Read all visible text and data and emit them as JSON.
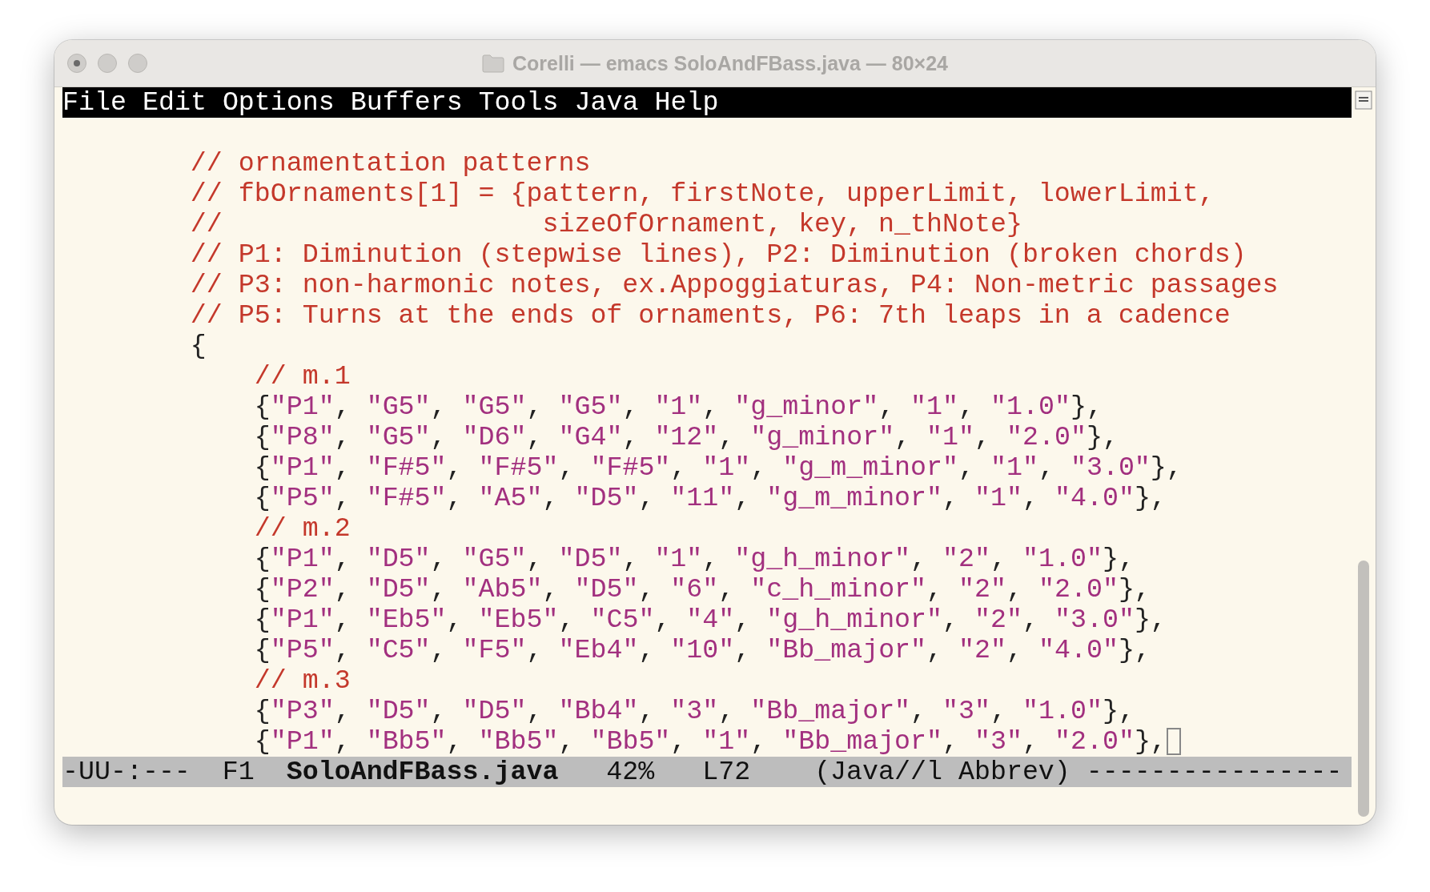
{
  "window": {
    "title": "Corelli — emacs SoloAndFBass.java — 80×24"
  },
  "menu_bar": [
    "File",
    "Edit",
    "Options",
    "Buffers",
    "Tools",
    "Java",
    "Help"
  ],
  "header_comments": [
    "// ornamentation patterns",
    "// fbOrnaments[1] = {pattern, firstNote, upperLimit, lowerLimit,",
    "//                    sizeOfOrnament, key, n_thNote}",
    "// P1: Diminution (stepwise lines), P2: Diminution (broken chords)",
    "// P3: non-harmonic notes, ex.Appoggiaturas, P4: Non-metric passages",
    "// P5: Turns at the ends of ornaments, P6: 7th leaps in a cadence"
  ],
  "block": {
    "open": "{",
    "groups": [
      {
        "comment": "// m.1",
        "rows": [
          {
            "text": "{\"P1\", \"G5\", \"G5\", \"G5\", \"1\", \"g_minor\", \"1\", \"1.0\"},",
            "cursor": false
          },
          {
            "text": "{\"P8\", \"G5\", \"D6\", \"G4\", \"12\", \"g_minor\", \"1\", \"2.0\"},",
            "cursor": false
          },
          {
            "text": "{\"P1\", \"F#5\", \"F#5\", \"F#5\", \"1\", \"g_m_minor\", \"1\", \"3.0\"},",
            "cursor": false
          },
          {
            "text": "{\"P5\", \"F#5\", \"A5\", \"D5\", \"11\", \"g_m_minor\", \"1\", \"4.0\"},",
            "cursor": false
          }
        ]
      },
      {
        "comment": "// m.2",
        "rows": [
          {
            "text": "{\"P1\", \"D5\", \"G5\", \"D5\", \"1\", \"g_h_minor\", \"2\", \"1.0\"},",
            "cursor": false
          },
          {
            "text": "{\"P2\", \"D5\", \"Ab5\", \"D5\", \"6\", \"c_h_minor\", \"2\", \"2.0\"},",
            "cursor": false
          },
          {
            "text": "{\"P1\", \"Eb5\", \"Eb5\", \"C5\", \"4\", \"g_h_minor\", \"2\", \"3.0\"},",
            "cursor": false
          },
          {
            "text": "{\"P5\", \"C5\", \"F5\", \"Eb4\", \"10\", \"Bb_major\", \"2\", \"4.0\"},",
            "cursor": false
          }
        ]
      },
      {
        "comment": "// m.3",
        "rows": [
          {
            "text": "{\"P3\", \"D5\", \"D5\", \"Bb4\", \"3\", \"Bb_major\", \"3\", \"1.0\"},",
            "cursor": false
          },
          {
            "text": "{\"P1\", \"Bb5\", \"Bb5\", \"Bb5\", \"1\", \"Bb_major\", \"3\", \"2.0\"},",
            "cursor": true
          }
        ]
      }
    ]
  },
  "mode_line": [
    {
      "text": "-UU-:---",
      "bold": false
    },
    {
      "text": "F1",
      "bold": false
    },
    {
      "text": "SoloAndFBass.java",
      "bold": true
    },
    {
      "text": "42%",
      "bold": false
    },
    {
      "text": "L72",
      "bold": false
    },
    {
      "text": "(Java//l Abbrev)",
      "bold": false
    },
    {
      "text": "----------------",
      "bold": false
    }
  ]
}
